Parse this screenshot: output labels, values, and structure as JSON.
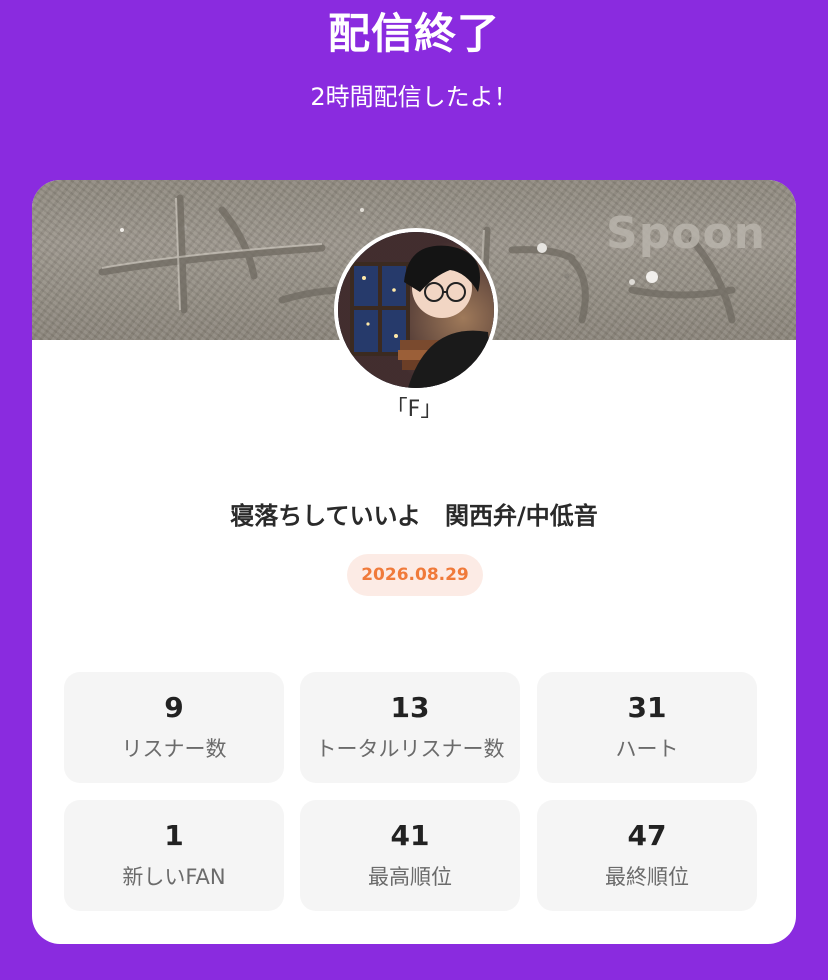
{
  "header": {
    "title": "配信終了",
    "subtitle": "2時間配信したよ！"
  },
  "banner": {
    "watermark": "Spoon"
  },
  "profile": {
    "username": "「F」",
    "avatar_icon": "user-avatar-illustration"
  },
  "stream": {
    "title": "寝落ちしていいよ　関西弁/中低音",
    "date": "2026.08.29"
  },
  "stats": [
    {
      "value": "9",
      "label": "リスナー数"
    },
    {
      "value": "13",
      "label": "トータルリスナー数"
    },
    {
      "value": "31",
      "label": "ハート"
    },
    {
      "value": "1",
      "label": "新しいFAN"
    },
    {
      "value": "41",
      "label": "最高順位"
    },
    {
      "value": "47",
      "label": "最終順位"
    }
  ],
  "colors": {
    "background": "#8a2bdf",
    "date_text": "#f07a3a",
    "date_badge_bg": "#fcebe5"
  }
}
